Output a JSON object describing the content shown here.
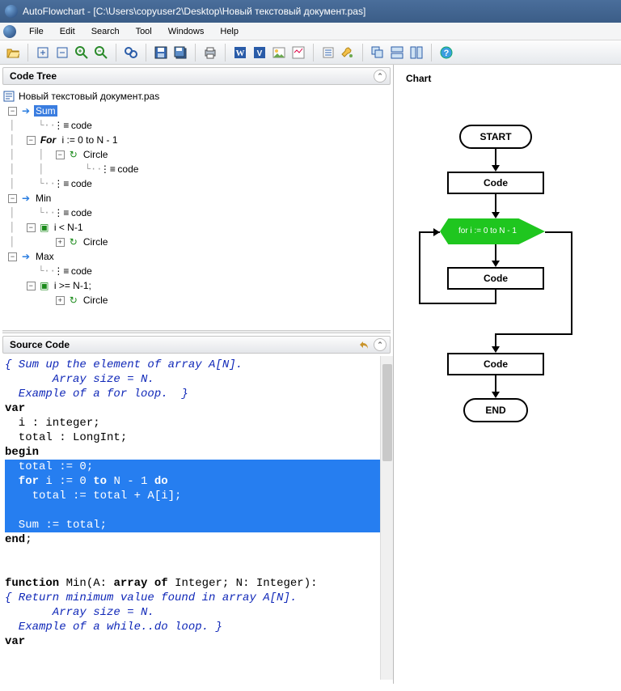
{
  "title": "AutoFlowchart - [C:\\Users\\copyuser2\\Desktop\\Новый текстовый документ.pas]",
  "menus": [
    "File",
    "Edit",
    "Search",
    "Tool",
    "Windows",
    "Help"
  ],
  "panels": {
    "codetree": "Code Tree",
    "source": "Source Code",
    "chart": "Chart"
  },
  "tree": {
    "file": "Новый текстовый документ.pas",
    "sum": "Sum",
    "sum_code": "code",
    "for": "For",
    "for_range": "i := 0 to N - 1",
    "circle": "Circle",
    "code": "code",
    "min": "Min",
    "min_cond": "i < N-1",
    "max": "Max",
    "max_cond": "i >= N-1;"
  },
  "source": {
    "c1": "{ Sum up the element of array A[N].",
    "c2": "       Array size = N.",
    "c3": "  Example of a for loop.  }",
    "l4_a": "var",
    "l5": "  i : integer;",
    "l6": "  total : LongInt;",
    "l7_a": "begin",
    "s1": "  total := 0;",
    "s2_a": "  for ",
    "s2_b": "i := 0 ",
    "s2_c": "to ",
    "s2_d": "N - 1 ",
    "s2_e": "do",
    "s3": "    total := total + A[i];",
    "s4": "",
    "s5": "  Sum := total;",
    "l13_a": "end",
    "l13_b": ";",
    "l15_a": "function ",
    "l15_b": "Min(A: ",
    "l15_c": "array of ",
    "l15_d": "Integer; N: Integer):",
    "c16": "{ Return minimum value found in array A[N].",
    "c17": "       Array size = N.",
    "c18": "  Example of a while..do loop. }",
    "l19": "var"
  },
  "chart_data": {
    "type": "flowchart",
    "nodes": [
      {
        "id": "start",
        "shape": "terminator",
        "label": "START"
      },
      {
        "id": "code1",
        "shape": "process",
        "label": "Code"
      },
      {
        "id": "loop",
        "shape": "decision",
        "label": "for i := 0 to N - 1",
        "highlighted": true
      },
      {
        "id": "code2",
        "shape": "process",
        "label": "Code"
      },
      {
        "id": "code3",
        "shape": "process",
        "label": "Code"
      },
      {
        "id": "end",
        "shape": "terminator",
        "label": "END"
      }
    ],
    "edges": [
      [
        "start",
        "code1"
      ],
      [
        "code1",
        "loop"
      ],
      [
        "loop",
        "code2"
      ],
      [
        "code2",
        "loop"
      ],
      [
        "loop",
        "code3"
      ],
      [
        "code3",
        "end"
      ]
    ]
  },
  "flowlabels": {
    "start": "START",
    "code": "Code",
    "loop": "for i := 0 to N - 1",
    "end": "END"
  }
}
